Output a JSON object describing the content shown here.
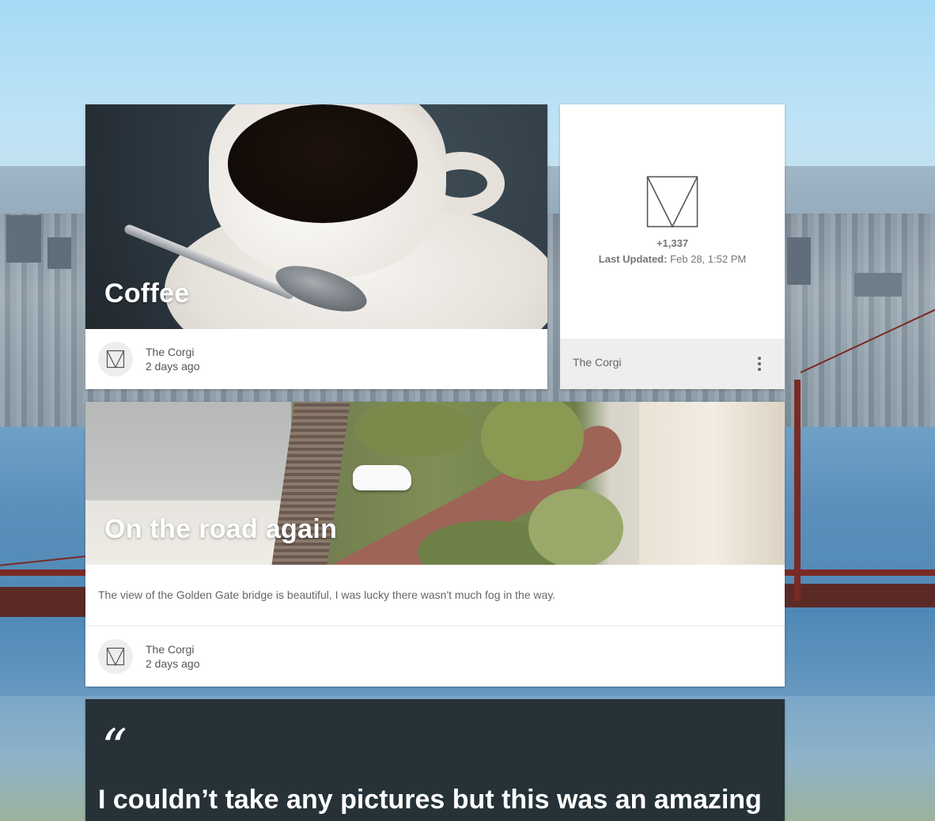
{
  "cards": {
    "coffee": {
      "title": "Coffee",
      "author": "The Corgi",
      "time": "2 days ago"
    },
    "stat": {
      "value": "+1,337",
      "updated_label": "Last Updated:",
      "updated_value": "Feb 28, 1:52 PM",
      "author": "The Corgi",
      "menu_icon": "more-vert-icon"
    },
    "road": {
      "title": "On the road again",
      "description": "The view of the Golden Gate bridge is beautiful, I was lucky there wasn't much fog in the way.",
      "author": "The Corgi",
      "time": "2 days ago"
    },
    "quote": {
      "mark": "“",
      "text": "I couldn’t take any pictures but this was an amazing"
    }
  },
  "colors": {
    "quote_bg": "#263238",
    "card_bg": "#ffffff",
    "footer_bg": "#eeeeee"
  }
}
